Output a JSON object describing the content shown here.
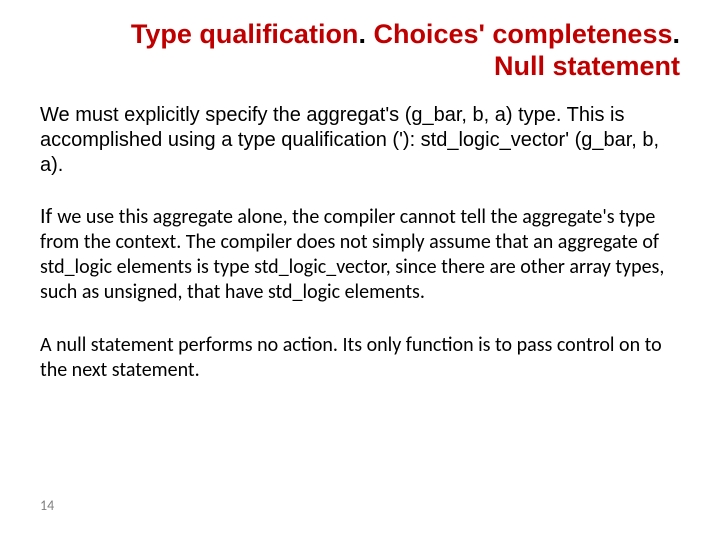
{
  "title": {
    "line1_part1": "Type qualification",
    "line1_part2": ". ",
    "line1_part3": "Choices' completeness",
    "line1_part4": ".",
    "line2": "Null statement"
  },
  "body": {
    "p1": "We must explicitly specify the aggregat's (g_bar, b, a) type. This is accomplished using a type qualification ('): std_logic_vector' (g_bar, b, a).",
    "p2_lead": "If ",
    "p2_rest": "we use this aggregate alone, the compiler cannot tell the aggregate's type from the context. The compiler does not simply assume that an aggregate of std_logic elements is type std_logic_vector, since there are other array types, such as unsigned, that have std_logic elements.",
    "p3": "A null statement performs no action. Its only function is to pass control on to the next statement."
  },
  "page_number": "14"
}
